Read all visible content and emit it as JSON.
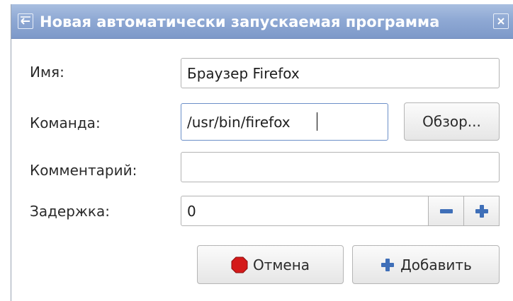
{
  "window": {
    "title": "Новая автоматически запускаемая программа",
    "menu_icon": "window-menu-icon",
    "close_icon": "close-icon"
  },
  "form": {
    "name_label": "Имя:",
    "name_value": "Браузер Firefox",
    "command_label": "Команда:",
    "command_value": "/usr/bin/firefox",
    "browse_button": "Обзор...",
    "comment_label": "Комментарий:",
    "comment_value": "",
    "delay_label": "Задержка:",
    "delay_value": "0"
  },
  "buttons": {
    "cancel_label": "Отмена",
    "cancel_icon": "stop-icon",
    "add_label": "Добавить",
    "add_icon": "plus-icon"
  },
  "colors": {
    "titlebar": "#8fa9d4",
    "stop_red": "#d41a1a",
    "plus_blue": "#3f6fb8"
  }
}
